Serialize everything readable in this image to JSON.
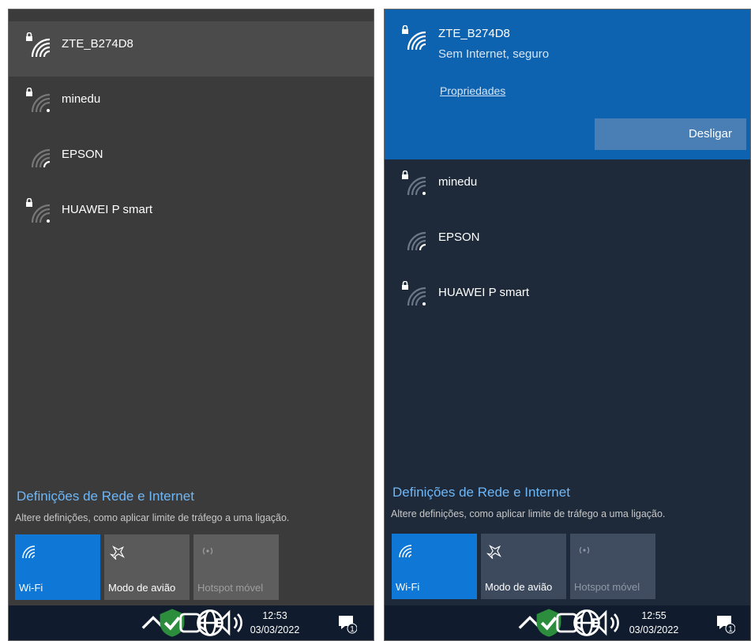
{
  "left": {
    "networks": [
      {
        "ssid": "ZTE_B274D8",
        "secured": true,
        "selected": true
      },
      {
        "ssid": "minedu",
        "secured": true,
        "selected": false
      },
      {
        "ssid": "EPSON",
        "secured": false,
        "selected": false
      },
      {
        "ssid": "HUAWEI P smart",
        "secured": true,
        "selected": false
      }
    ],
    "settings_title": "Definições de Rede e Internet",
    "settings_desc": "Altere definições, como aplicar limite de tráfego a uma ligação.",
    "tiles": [
      {
        "label": "Wi-Fi",
        "state": "on",
        "icon": "wifi-icon"
      },
      {
        "label": "Modo de avião",
        "state": "off",
        "icon": "airplane-icon"
      },
      {
        "label": "Hotspot móvel",
        "state": "disabled",
        "icon": "hotspot-icon"
      }
    ],
    "taskbar": {
      "time": "12:53",
      "date": "03/03/2022",
      "notification_count": "1"
    }
  },
  "right": {
    "connected": {
      "ssid": "ZTE_B274D8",
      "status": "Sem Internet, seguro",
      "properties_label": "Propriedades",
      "disconnect_label": "Desligar"
    },
    "networks": [
      {
        "ssid": "minedu",
        "secured": true
      },
      {
        "ssid": "EPSON",
        "secured": false
      },
      {
        "ssid": "HUAWEI P smart",
        "secured": true
      }
    ],
    "settings_title": "Definições de Rede e Internet",
    "settings_desc": "Altere definições, como aplicar limite de tráfego a uma ligação.",
    "tiles": [
      {
        "label": "Wi-Fi",
        "state": "on",
        "icon": "wifi-icon"
      },
      {
        "label": "Modo de avião",
        "state": "off",
        "icon": "airplane-icon"
      },
      {
        "label": "Hotspot móvel",
        "state": "disabled",
        "icon": "hotspot-icon"
      }
    ],
    "taskbar": {
      "time": "12:55",
      "date": "03/03/2022",
      "notification_count": "1"
    }
  },
  "colors": {
    "accent": "#0f78d7",
    "link": "#6fb6f5",
    "selected_right": "#0e63b0"
  }
}
